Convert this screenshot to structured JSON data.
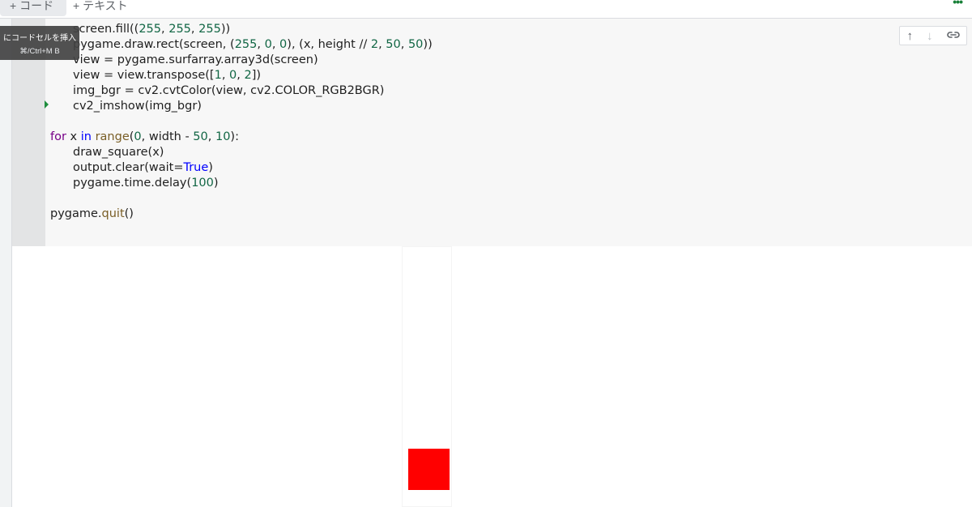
{
  "toolbar": {
    "add_code_label": "+ コード",
    "add_text_label": "+ テキスト",
    "more_label": "•••"
  },
  "tooltip": {
    "title": "にコードセルを挿入",
    "shortcut": "⌘/Ctrl+M B"
  },
  "cell_toolbar": {
    "move_up_icon": "↑",
    "move_down_icon": "↓",
    "link_icon": "⛓"
  },
  "code": {
    "lines": [
      {
        "indent": true,
        "tokens": [
          {
            "t": "screen.fill(("
          },
          {
            "t": "255",
            "c": "num"
          },
          {
            "t": ", "
          },
          {
            "t": "255",
            "c": "num"
          },
          {
            "t": ", "
          },
          {
            "t": "255",
            "c": "num"
          },
          {
            "t": "))"
          }
        ]
      },
      {
        "indent": true,
        "tokens": [
          {
            "t": "pygame.draw.rect(screen, ("
          },
          {
            "t": "255",
            "c": "num"
          },
          {
            "t": ", "
          },
          {
            "t": "0",
            "c": "num"
          },
          {
            "t": ", "
          },
          {
            "t": "0",
            "c": "num"
          },
          {
            "t": "), (x, height // "
          },
          {
            "t": "2",
            "c": "num"
          },
          {
            "t": ", "
          },
          {
            "t": "50",
            "c": "num"
          },
          {
            "t": ", "
          },
          {
            "t": "50",
            "c": "num"
          },
          {
            "t": "))"
          }
        ]
      },
      {
        "indent": true,
        "tokens": [
          {
            "t": "view = pygame.surfarray.array3d(screen)"
          }
        ]
      },
      {
        "indent": true,
        "tokens": [
          {
            "t": "view = view.transpose(["
          },
          {
            "t": "1",
            "c": "num"
          },
          {
            "t": ", "
          },
          {
            "t": "0",
            "c": "num"
          },
          {
            "t": ", "
          },
          {
            "t": "2",
            "c": "num"
          },
          {
            "t": "])"
          }
        ]
      },
      {
        "indent": true,
        "tokens": [
          {
            "t": "img_bgr = cv2.cvtColor(view, cv2.COLOR_RGB2BGR)"
          }
        ]
      },
      {
        "indent": true,
        "tokens": [
          {
            "t": "cv2_imshow(img_bgr)"
          }
        ]
      },
      {
        "indent": false,
        "tokens": [
          {
            "t": ""
          }
        ]
      },
      {
        "indent": false,
        "tokens": [
          {
            "t": "for",
            "c": "kw"
          },
          {
            "t": " x "
          },
          {
            "t": "in",
            "c": "op"
          },
          {
            "t": " "
          },
          {
            "t": "range",
            "c": "fn"
          },
          {
            "t": "("
          },
          {
            "t": "0",
            "c": "num"
          },
          {
            "t": ", width - "
          },
          {
            "t": "50",
            "c": "num"
          },
          {
            "t": ", "
          },
          {
            "t": "10",
            "c": "num"
          },
          {
            "t": "):"
          }
        ]
      },
      {
        "indent": true,
        "tokens": [
          {
            "t": "draw_square(x)"
          }
        ]
      },
      {
        "indent": true,
        "tokens": [
          {
            "t": "output.clear(wait="
          },
          {
            "t": "True",
            "c": "bool"
          },
          {
            "t": ")"
          }
        ]
      },
      {
        "indent": true,
        "tokens": [
          {
            "t": "pygame.time.delay("
          },
          {
            "t": "100",
            "c": "num"
          },
          {
            "t": ")"
          }
        ]
      },
      {
        "indent": false,
        "tokens": [
          {
            "t": ""
          }
        ]
      },
      {
        "indent": false,
        "tokens": [
          {
            "t": "pygame."
          },
          {
            "t": "quit",
            "c": "fn"
          },
          {
            "t": "()"
          }
        ]
      }
    ]
  },
  "output": {
    "square_color": "#ff0000"
  },
  "colors": {
    "accent_green": "#1e8e3e",
    "number": "#116644",
    "keyword": "#770088"
  }
}
